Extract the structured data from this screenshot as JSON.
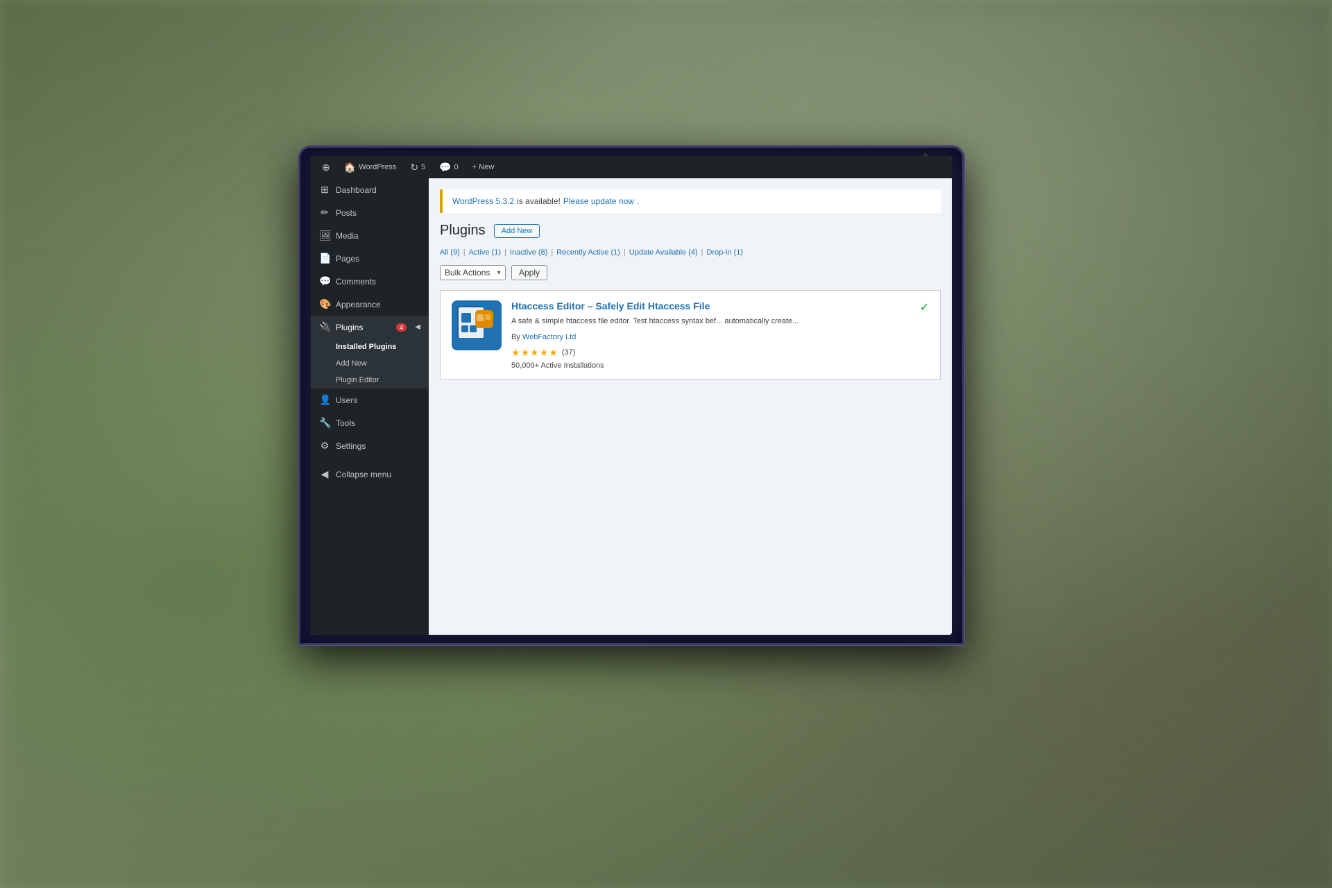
{
  "background": {
    "color": "#6b7c5a"
  },
  "admin_bar": {
    "wp_logo": "⊕",
    "home_icon": "🏠",
    "site_name": "WordPress",
    "updates_icon": "↻",
    "updates_count": "5",
    "comments_icon": "💬",
    "comments_count": "0",
    "new_label": "+ New"
  },
  "sidebar": {
    "items": [
      {
        "id": "dashboard",
        "icon": "⊞",
        "label": "Dashboard"
      },
      {
        "id": "posts",
        "icon": "✏",
        "label": "Posts"
      },
      {
        "id": "media",
        "icon": "🖼",
        "label": "Media"
      },
      {
        "id": "pages",
        "icon": "📄",
        "label": "Pages"
      },
      {
        "id": "comments",
        "icon": "💬",
        "label": "Comments"
      },
      {
        "id": "appearance",
        "icon": "🎨",
        "label": "Appearance"
      },
      {
        "id": "plugins",
        "icon": "🔌",
        "label": "Plugins",
        "badge": "4",
        "active": true
      },
      {
        "id": "users",
        "icon": "👤",
        "label": "Users"
      },
      {
        "id": "tools",
        "icon": "🔧",
        "label": "Tools"
      },
      {
        "id": "settings",
        "icon": "⚙",
        "label": "Settings"
      },
      {
        "id": "collapse",
        "icon": "◀",
        "label": "Collapse menu"
      }
    ],
    "plugins_submenu": [
      {
        "id": "installed-plugins",
        "label": "Installed Plugins",
        "active": true
      },
      {
        "id": "add-new",
        "label": "Add New"
      },
      {
        "id": "plugin-editor",
        "label": "Plugin Editor"
      }
    ]
  },
  "main": {
    "update_notice": {
      "version_link_text": "WordPress 5.3.2",
      "message": " is available! ",
      "update_link_text": "Please update now",
      "update_link_end": "."
    },
    "page_title": "Plugins",
    "add_new_button": "Add New",
    "filter_links": [
      {
        "label": "All",
        "count": "(9)"
      },
      {
        "label": "Active",
        "count": "(1)"
      },
      {
        "label": "Inactive",
        "count": "(8)"
      },
      {
        "label": "Recently Active",
        "count": "(1)"
      },
      {
        "label": "Update Available",
        "count": "(4)"
      },
      {
        "label": "Drop-in",
        "count": "(1)"
      }
    ],
    "bulk_actions": {
      "select_label": "Bulk Actions",
      "apply_label": "Apply"
    },
    "plugin": {
      "name": "Htaccess Editor – Safely Edit Htaccess File",
      "description": "A safe & simple htaccess file editor. Test htaccess syntax bef... automatically create...",
      "author_prefix": "By ",
      "author": "WebFactory Ltd",
      "rating_stars": 5,
      "rating_count": "(37)",
      "installations": "50,000+ Active Installations"
    }
  }
}
